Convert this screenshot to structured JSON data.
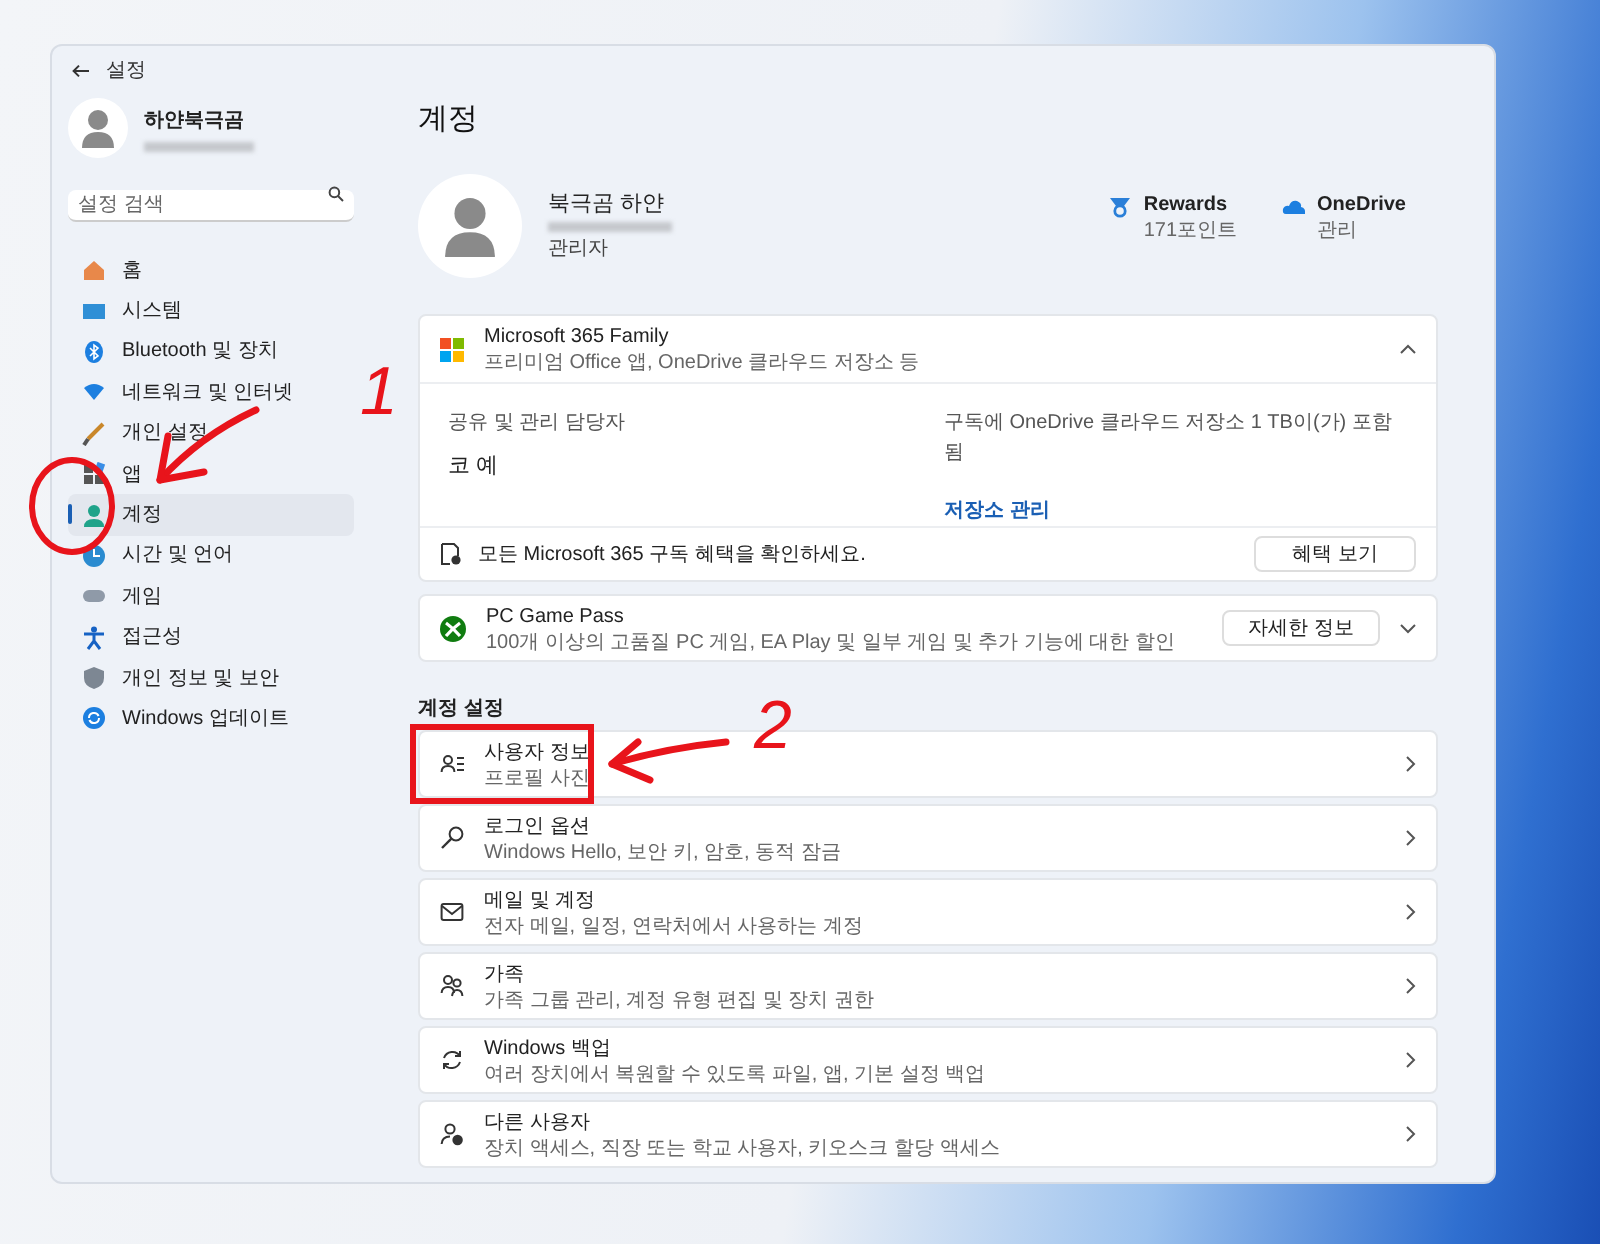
{
  "window": {
    "title": "설정"
  },
  "sidebar": {
    "profile": {
      "name": "하얀북극곰"
    },
    "search": {
      "placeholder": "설정 검색"
    },
    "items": [
      {
        "label": "홈",
        "selected": false
      },
      {
        "label": "시스템",
        "selected": false
      },
      {
        "label": "Bluetooth 및 장치",
        "selected": false
      },
      {
        "label": "네트워크 및 인터넷",
        "selected": false
      },
      {
        "label": "개인 설정",
        "selected": false
      },
      {
        "label": "앱",
        "selected": false
      },
      {
        "label": "계정",
        "selected": true
      },
      {
        "label": "시간 및 언어",
        "selected": false
      },
      {
        "label": "게임",
        "selected": false
      },
      {
        "label": "접근성",
        "selected": false
      },
      {
        "label": "개인 정보 및 보안",
        "selected": false
      },
      {
        "label": "Windows 업데이트",
        "selected": false
      }
    ]
  },
  "page": {
    "title": "계정",
    "profile": {
      "name": "북극곰 하얀",
      "role": "관리자"
    },
    "services": [
      {
        "name": "Rewards",
        "detail": "171포인트"
      },
      {
        "name": "OneDrive",
        "detail": "관리"
      }
    ],
    "m365": {
      "title": "Microsoft 365 Family",
      "subtitle": "프리미엄 Office 앱, OneDrive 클라우드 저장소 등",
      "expanded": true,
      "sharing_label": "공유 및 관리 담당자",
      "sharing_value": "코 예",
      "storage_label": "구독에 OneDrive 클라우드 저장소 1 TB이(가) 포함됨",
      "storage_link": "저장소 관리",
      "benefits_text": "모든 Microsoft 365 구독 혜택을 확인하세요.",
      "benefits_button": "혜택 보기"
    },
    "game_pass": {
      "title": "PC Game Pass",
      "subtitle": "100개 이상의 고품질 PC 게임, EA Play 및 일부 게임 및 추가 기능에 대한 할인",
      "button": "자세한 정보",
      "expanded": false
    },
    "section_title": "계정 설정",
    "settings": [
      {
        "title": "사용자 정보",
        "subtitle": "프로필 사진"
      },
      {
        "title": "로그인 옵션",
        "subtitle": "Windows Hello, 보안 키, 암호, 동적 잠금"
      },
      {
        "title": "메일 및 계정",
        "subtitle": "전자 메일, 일정, 연락처에서 사용하는 계정"
      },
      {
        "title": "가족",
        "subtitle": "가족 그룹 관리, 계정 유형 편집 및 장치 권한"
      },
      {
        "title": "Windows 백업",
        "subtitle": "여러 장치에서 복원할 수 있도록 파일, 앱, 기본 설정 백업"
      },
      {
        "title": "다른 사용자",
        "subtitle": "장치 액세스, 직장 또는 학교 사용자, 키오스크 할당 액세스"
      }
    ]
  },
  "annotations": [
    {
      "label": "1"
    },
    {
      "label": "2"
    }
  ]
}
